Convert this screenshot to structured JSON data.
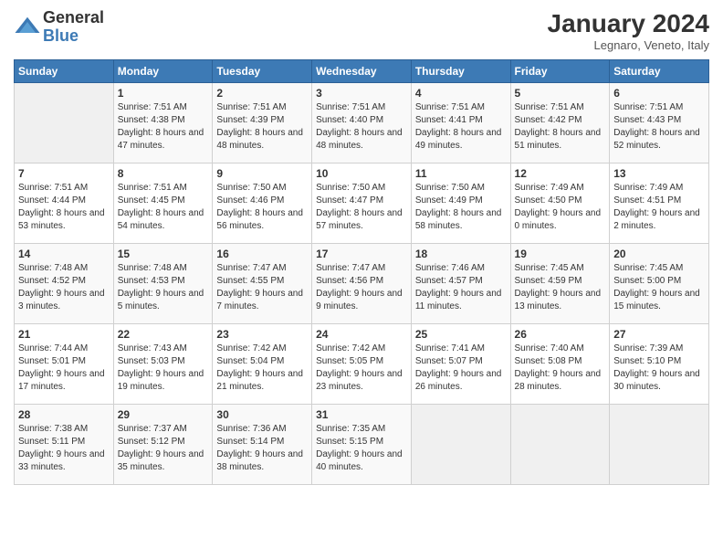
{
  "logo": {
    "general": "General",
    "blue": "Blue"
  },
  "title": "January 2024",
  "subtitle": "Legnaro, Veneto, Italy",
  "headers": [
    "Sunday",
    "Monday",
    "Tuesday",
    "Wednesday",
    "Thursday",
    "Friday",
    "Saturday"
  ],
  "weeks": [
    [
      {
        "day": "",
        "sunrise": "",
        "sunset": "",
        "daylight": ""
      },
      {
        "day": "1",
        "sunrise": "Sunrise: 7:51 AM",
        "sunset": "Sunset: 4:38 PM",
        "daylight": "Daylight: 8 hours and 47 minutes."
      },
      {
        "day": "2",
        "sunrise": "Sunrise: 7:51 AM",
        "sunset": "Sunset: 4:39 PM",
        "daylight": "Daylight: 8 hours and 48 minutes."
      },
      {
        "day": "3",
        "sunrise": "Sunrise: 7:51 AM",
        "sunset": "Sunset: 4:40 PM",
        "daylight": "Daylight: 8 hours and 48 minutes."
      },
      {
        "day": "4",
        "sunrise": "Sunrise: 7:51 AM",
        "sunset": "Sunset: 4:41 PM",
        "daylight": "Daylight: 8 hours and 49 minutes."
      },
      {
        "day": "5",
        "sunrise": "Sunrise: 7:51 AM",
        "sunset": "Sunset: 4:42 PM",
        "daylight": "Daylight: 8 hours and 51 minutes."
      },
      {
        "day": "6",
        "sunrise": "Sunrise: 7:51 AM",
        "sunset": "Sunset: 4:43 PM",
        "daylight": "Daylight: 8 hours and 52 minutes."
      }
    ],
    [
      {
        "day": "7",
        "sunrise": "Sunrise: 7:51 AM",
        "sunset": "Sunset: 4:44 PM",
        "daylight": "Daylight: 8 hours and 53 minutes."
      },
      {
        "day": "8",
        "sunrise": "Sunrise: 7:51 AM",
        "sunset": "Sunset: 4:45 PM",
        "daylight": "Daylight: 8 hours and 54 minutes."
      },
      {
        "day": "9",
        "sunrise": "Sunrise: 7:50 AM",
        "sunset": "Sunset: 4:46 PM",
        "daylight": "Daylight: 8 hours and 56 minutes."
      },
      {
        "day": "10",
        "sunrise": "Sunrise: 7:50 AM",
        "sunset": "Sunset: 4:47 PM",
        "daylight": "Daylight: 8 hours and 57 minutes."
      },
      {
        "day": "11",
        "sunrise": "Sunrise: 7:50 AM",
        "sunset": "Sunset: 4:49 PM",
        "daylight": "Daylight: 8 hours and 58 minutes."
      },
      {
        "day": "12",
        "sunrise": "Sunrise: 7:49 AM",
        "sunset": "Sunset: 4:50 PM",
        "daylight": "Daylight: 9 hours and 0 minutes."
      },
      {
        "day": "13",
        "sunrise": "Sunrise: 7:49 AM",
        "sunset": "Sunset: 4:51 PM",
        "daylight": "Daylight: 9 hours and 2 minutes."
      }
    ],
    [
      {
        "day": "14",
        "sunrise": "Sunrise: 7:48 AM",
        "sunset": "Sunset: 4:52 PM",
        "daylight": "Daylight: 9 hours and 3 minutes."
      },
      {
        "day": "15",
        "sunrise": "Sunrise: 7:48 AM",
        "sunset": "Sunset: 4:53 PM",
        "daylight": "Daylight: 9 hours and 5 minutes."
      },
      {
        "day": "16",
        "sunrise": "Sunrise: 7:47 AM",
        "sunset": "Sunset: 4:55 PM",
        "daylight": "Daylight: 9 hours and 7 minutes."
      },
      {
        "day": "17",
        "sunrise": "Sunrise: 7:47 AM",
        "sunset": "Sunset: 4:56 PM",
        "daylight": "Daylight: 9 hours and 9 minutes."
      },
      {
        "day": "18",
        "sunrise": "Sunrise: 7:46 AM",
        "sunset": "Sunset: 4:57 PM",
        "daylight": "Daylight: 9 hours and 11 minutes."
      },
      {
        "day": "19",
        "sunrise": "Sunrise: 7:45 AM",
        "sunset": "Sunset: 4:59 PM",
        "daylight": "Daylight: 9 hours and 13 minutes."
      },
      {
        "day": "20",
        "sunrise": "Sunrise: 7:45 AM",
        "sunset": "Sunset: 5:00 PM",
        "daylight": "Daylight: 9 hours and 15 minutes."
      }
    ],
    [
      {
        "day": "21",
        "sunrise": "Sunrise: 7:44 AM",
        "sunset": "Sunset: 5:01 PM",
        "daylight": "Daylight: 9 hours and 17 minutes."
      },
      {
        "day": "22",
        "sunrise": "Sunrise: 7:43 AM",
        "sunset": "Sunset: 5:03 PM",
        "daylight": "Daylight: 9 hours and 19 minutes."
      },
      {
        "day": "23",
        "sunrise": "Sunrise: 7:42 AM",
        "sunset": "Sunset: 5:04 PM",
        "daylight": "Daylight: 9 hours and 21 minutes."
      },
      {
        "day": "24",
        "sunrise": "Sunrise: 7:42 AM",
        "sunset": "Sunset: 5:05 PM",
        "daylight": "Daylight: 9 hours and 23 minutes."
      },
      {
        "day": "25",
        "sunrise": "Sunrise: 7:41 AM",
        "sunset": "Sunset: 5:07 PM",
        "daylight": "Daylight: 9 hours and 26 minutes."
      },
      {
        "day": "26",
        "sunrise": "Sunrise: 7:40 AM",
        "sunset": "Sunset: 5:08 PM",
        "daylight": "Daylight: 9 hours and 28 minutes."
      },
      {
        "day": "27",
        "sunrise": "Sunrise: 7:39 AM",
        "sunset": "Sunset: 5:10 PM",
        "daylight": "Daylight: 9 hours and 30 minutes."
      }
    ],
    [
      {
        "day": "28",
        "sunrise": "Sunrise: 7:38 AM",
        "sunset": "Sunset: 5:11 PM",
        "daylight": "Daylight: 9 hours and 33 minutes."
      },
      {
        "day": "29",
        "sunrise": "Sunrise: 7:37 AM",
        "sunset": "Sunset: 5:12 PM",
        "daylight": "Daylight: 9 hours and 35 minutes."
      },
      {
        "day": "30",
        "sunrise": "Sunrise: 7:36 AM",
        "sunset": "Sunset: 5:14 PM",
        "daylight": "Daylight: 9 hours and 38 minutes."
      },
      {
        "day": "31",
        "sunrise": "Sunrise: 7:35 AM",
        "sunset": "Sunset: 5:15 PM",
        "daylight": "Daylight: 9 hours and 40 minutes."
      },
      {
        "day": "",
        "sunrise": "",
        "sunset": "",
        "daylight": ""
      },
      {
        "day": "",
        "sunrise": "",
        "sunset": "",
        "daylight": ""
      },
      {
        "day": "",
        "sunrise": "",
        "sunset": "",
        "daylight": ""
      }
    ]
  ]
}
